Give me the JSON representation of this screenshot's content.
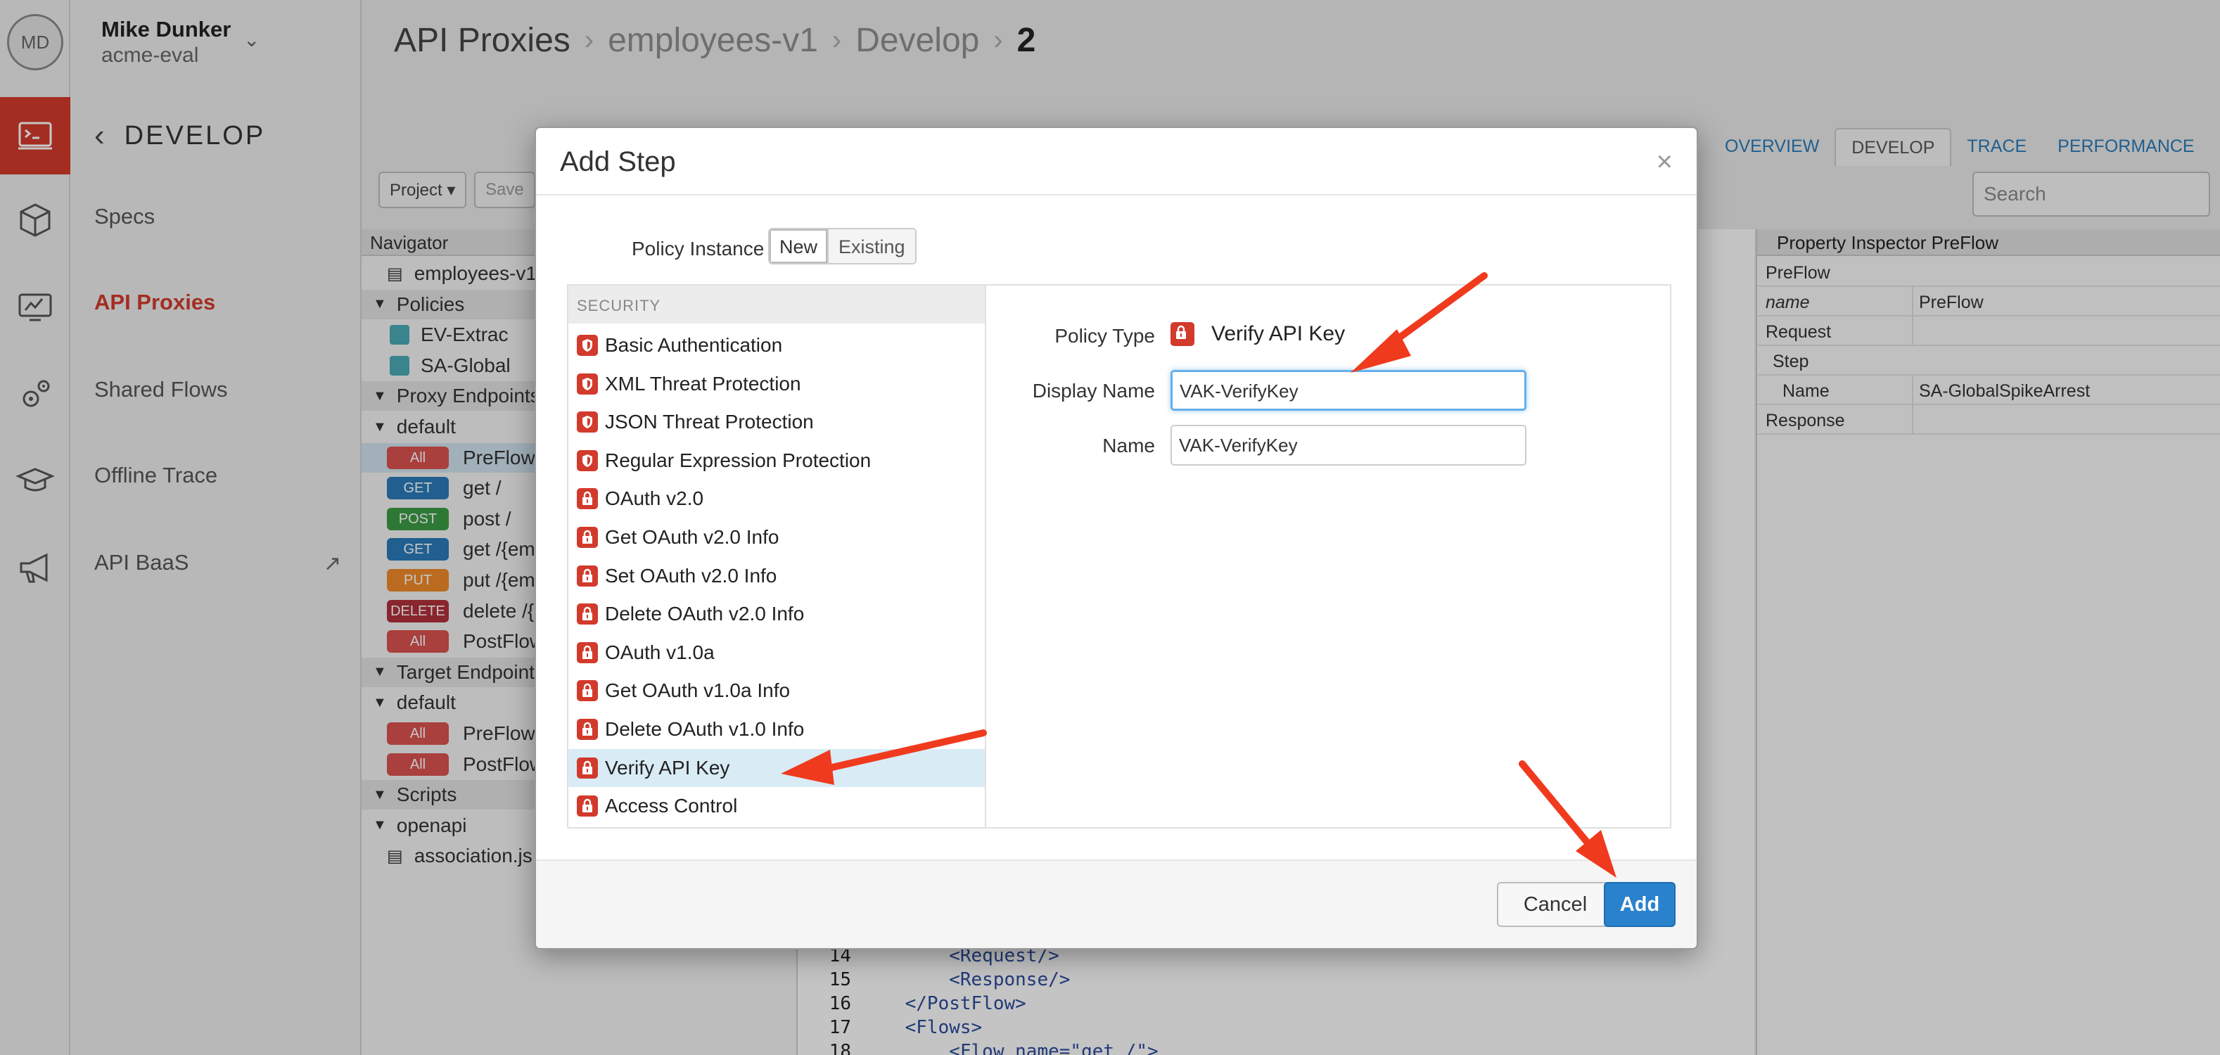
{
  "user": {
    "initials": "MD",
    "name": "Mike Dunker",
    "org": "acme-eval"
  },
  "rail": {
    "items": [
      {
        "icon": "terminal-icon",
        "active": true
      },
      {
        "icon": "package-icon",
        "active": false
      },
      {
        "icon": "dashboard-icon",
        "active": false
      },
      {
        "icon": "gears-icon",
        "active": false
      },
      {
        "icon": "graduation-cap-icon",
        "active": false
      },
      {
        "icon": "megaphone-icon",
        "active": false
      }
    ]
  },
  "sidenav": {
    "section_title": "DEVELOP",
    "items": [
      {
        "label": "Specs",
        "active": false
      },
      {
        "label": "API Proxies",
        "active": true
      },
      {
        "label": "Shared Flows",
        "active": false
      },
      {
        "label": "Offline Trace",
        "active": false
      },
      {
        "label": "API BaaS",
        "active": false,
        "external": true
      }
    ]
  },
  "breadcrumb": {
    "items": [
      "API Proxies",
      "employees-v1",
      "Develop"
    ],
    "current": "2"
  },
  "tabs": [
    "OVERVIEW",
    "DEVELOP",
    "TRACE",
    "PERFORMANCE"
  ],
  "active_tab": "DEVELOP",
  "search": {
    "placeholder": "Search"
  },
  "toolbar": {
    "project_label": "Project ▾",
    "save_label": "Save"
  },
  "navigator": {
    "header": "Navigator",
    "rows": [
      {
        "type": "file",
        "label": "employees-v1"
      },
      {
        "type": "section",
        "label": "Policies"
      },
      {
        "type": "policy",
        "label": "EV-Extrac"
      },
      {
        "type": "policy",
        "label": "SA-Global"
      },
      {
        "type": "section",
        "label": "Proxy Endpoints"
      },
      {
        "type": "group",
        "label": "default"
      },
      {
        "type": "flow",
        "badge": "All",
        "label": "PreFlow",
        "selected": true
      },
      {
        "type": "flow",
        "badge": "GET",
        "label": "get /"
      },
      {
        "type": "flow",
        "badge": "POST",
        "label": "post /"
      },
      {
        "type": "flow",
        "badge": "GET",
        "label": "get /{em"
      },
      {
        "type": "flow",
        "badge": "PUT",
        "label": "put /{em"
      },
      {
        "type": "flow",
        "badge": "DELETE",
        "label": "delete /{"
      },
      {
        "type": "flow",
        "badge": "All",
        "label": "PostFlow"
      },
      {
        "type": "section",
        "label": "Target Endpoints"
      },
      {
        "type": "group",
        "label": "default"
      },
      {
        "type": "flow",
        "badge": "All",
        "label": "PreFlow"
      },
      {
        "type": "flow",
        "badge": "All",
        "label": "PostFlow"
      },
      {
        "type": "section",
        "label": "Scripts"
      },
      {
        "type": "group",
        "label": "openapi"
      },
      {
        "type": "file",
        "label": "association.js"
      }
    ]
  },
  "code": [
    {
      "ln": "14",
      "text": "        <Request/>"
    },
    {
      "ln": "15",
      "text": "        <Response/>"
    },
    {
      "ln": "16",
      "text": "    </PostFlow>"
    },
    {
      "ln": "17",
      "text": "    <Flows>"
    },
    {
      "ln": "18",
      "text": "        <Flow name=\"get /\">"
    }
  ],
  "inspector": {
    "title": "Property Inspector  PreFlow",
    "rows": [
      {
        "k": "PreFlow",
        "v": ""
      },
      {
        "k": "name",
        "v": "PreFlow"
      },
      {
        "k": "Request",
        "v": ""
      },
      {
        "k": "Step",
        "v": ""
      },
      {
        "k": "Name",
        "v": "SA-GlobalSpikeArrest"
      },
      {
        "k": "Response",
        "v": ""
      }
    ],
    "add_step_label": "+ Step"
  },
  "modal": {
    "title": "Add Step",
    "close": "×",
    "policy_instance_label": "Policy Instance",
    "instance_options": [
      "New",
      "Existing"
    ],
    "instance_selected": "New",
    "category": "SECURITY",
    "policies": [
      {
        "label": "Basic Authentication",
        "icon": "shield-icon"
      },
      {
        "label": "XML Threat Protection",
        "icon": "shield-icon"
      },
      {
        "label": "JSON Threat Protection",
        "icon": "shield-icon"
      },
      {
        "label": "Regular Expression Protection",
        "icon": "shield-icon"
      },
      {
        "label": "OAuth v2.0",
        "icon": "lock-icon"
      },
      {
        "label": "Get OAuth v2.0 Info",
        "icon": "lock-icon"
      },
      {
        "label": "Set OAuth v2.0 Info",
        "icon": "lock-icon"
      },
      {
        "label": "Delete OAuth v2.0 Info",
        "icon": "lock-icon"
      },
      {
        "label": "OAuth v1.0a",
        "icon": "lock-icon"
      },
      {
        "label": "Get OAuth v1.0a Info",
        "icon": "lock-icon"
      },
      {
        "label": "Delete OAuth v1.0 Info",
        "icon": "lock-icon"
      },
      {
        "label": "Verify API Key",
        "icon": "lock-icon",
        "selected": true
      },
      {
        "label": "Access Control",
        "icon": "lock-icon"
      }
    ],
    "form": {
      "policy_type_label": "Policy Type",
      "policy_type_value": "Verify API Key",
      "display_name_label": "Display Name",
      "display_name_value": "VAK-VerifyKey",
      "name_label": "Name",
      "name_value": "VAK-VerifyKey"
    },
    "cancel_label": "Cancel",
    "add_label": "Add"
  },
  "colors": {
    "accent_red": "#d23a2c",
    "link_blue": "#2a7ab8",
    "primary_button": "#2a82cc",
    "annotation_arrow": "#f03a1e"
  }
}
